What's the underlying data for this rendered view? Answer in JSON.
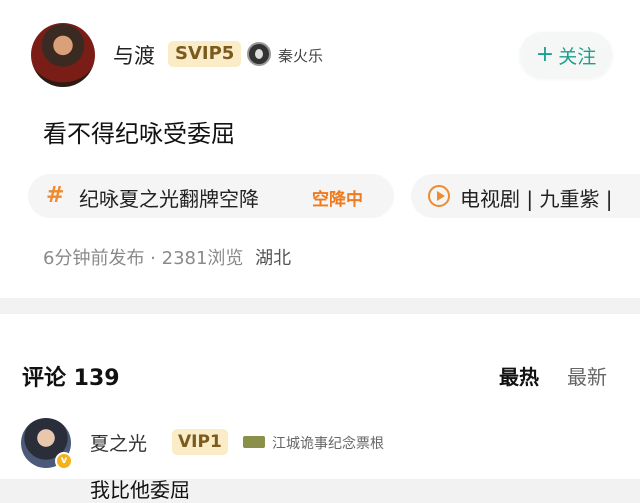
{
  "post": {
    "user_name": "与渡",
    "vip_level": "SVIP5",
    "medal_text": "秦火乐",
    "follow_label": "关注",
    "follow_plus": "+",
    "content": "看不得纪咏受委屈",
    "topic": {
      "label": "纪咏夏之光翻牌空降",
      "tag": "空降中"
    },
    "drama": {
      "label": "电视剧 | 九重紫 |"
    },
    "meta": {
      "time_views": "6分钟前发布 · 2381浏览",
      "location": "湖北"
    }
  },
  "comments": {
    "title": "评论 139",
    "sort_hot": "最热",
    "sort_new": "最新",
    "items": [
      {
        "name": "夏之光",
        "vip_level": "VIP1",
        "medal_text": "江城诡事纪念票根",
        "text": "我比他委屈"
      }
    ]
  },
  "colors": {
    "accent": "#1f9e8e",
    "topic_orange": "#f08a2e",
    "vip_bg": "#faecc6"
  }
}
